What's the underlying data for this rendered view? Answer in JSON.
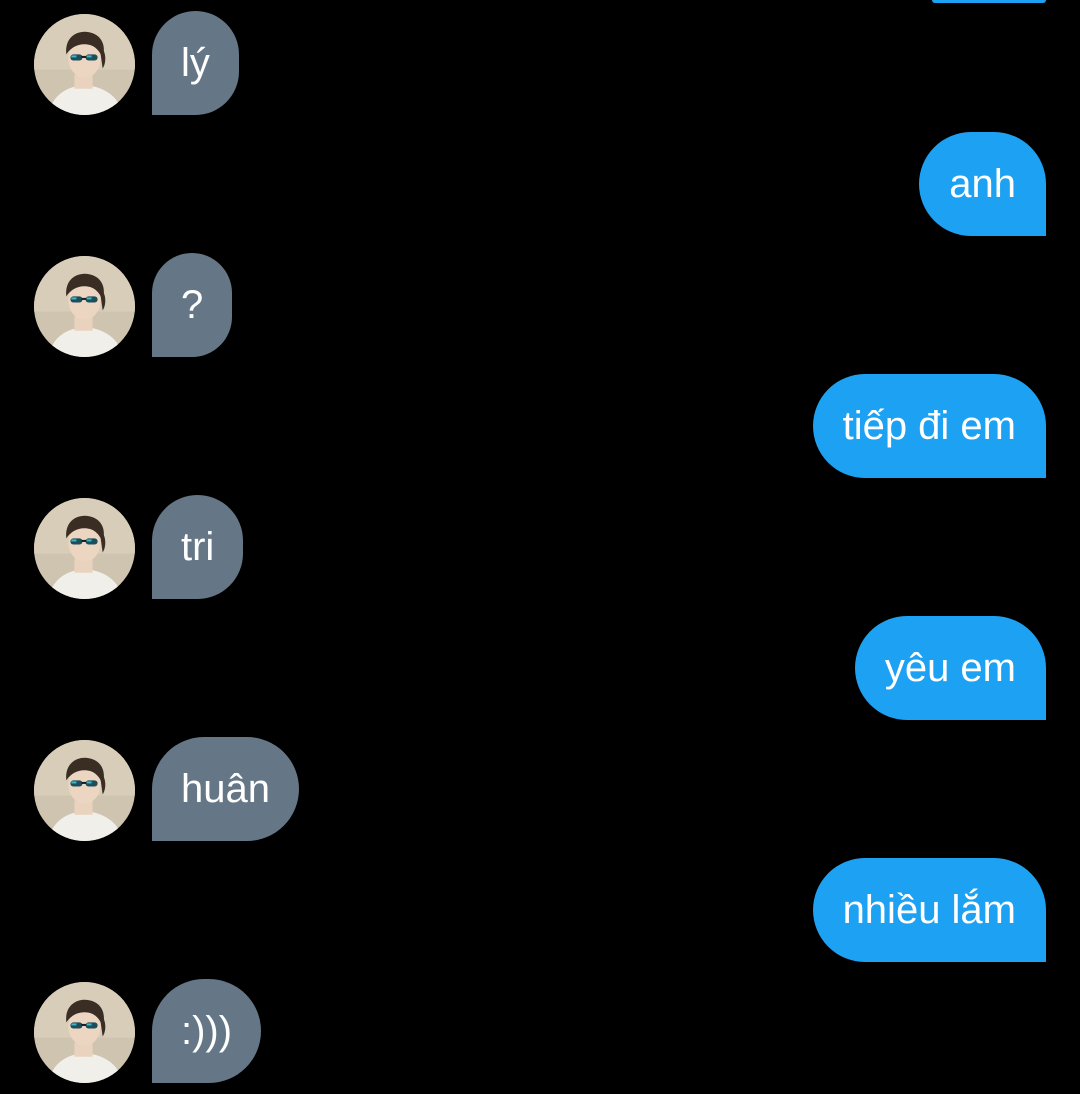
{
  "theme": {
    "background": "#000000",
    "incoming_bubble_color": "#657786",
    "outgoing_bubble_color": "#1DA1F2",
    "text_color": "#FFFFFF"
  },
  "conversation": {
    "messages": [
      {
        "direction": "incoming",
        "text": "lý",
        "avatar_icon": "user-avatar-icon"
      },
      {
        "direction": "outgoing",
        "text": "anh"
      },
      {
        "direction": "incoming",
        "text": "?",
        "avatar_icon": "user-avatar-icon"
      },
      {
        "direction": "outgoing",
        "text": "tiếp đi em"
      },
      {
        "direction": "incoming",
        "text": "tri",
        "avatar_icon": "user-avatar-icon"
      },
      {
        "direction": "outgoing",
        "text": "yêu em"
      },
      {
        "direction": "incoming",
        "text": "huân",
        "avatar_icon": "user-avatar-icon"
      },
      {
        "direction": "outgoing",
        "text": "nhiều lắm"
      },
      {
        "direction": "incoming",
        "text": ":)))",
        "avatar_icon": "user-avatar-icon"
      }
    ]
  }
}
